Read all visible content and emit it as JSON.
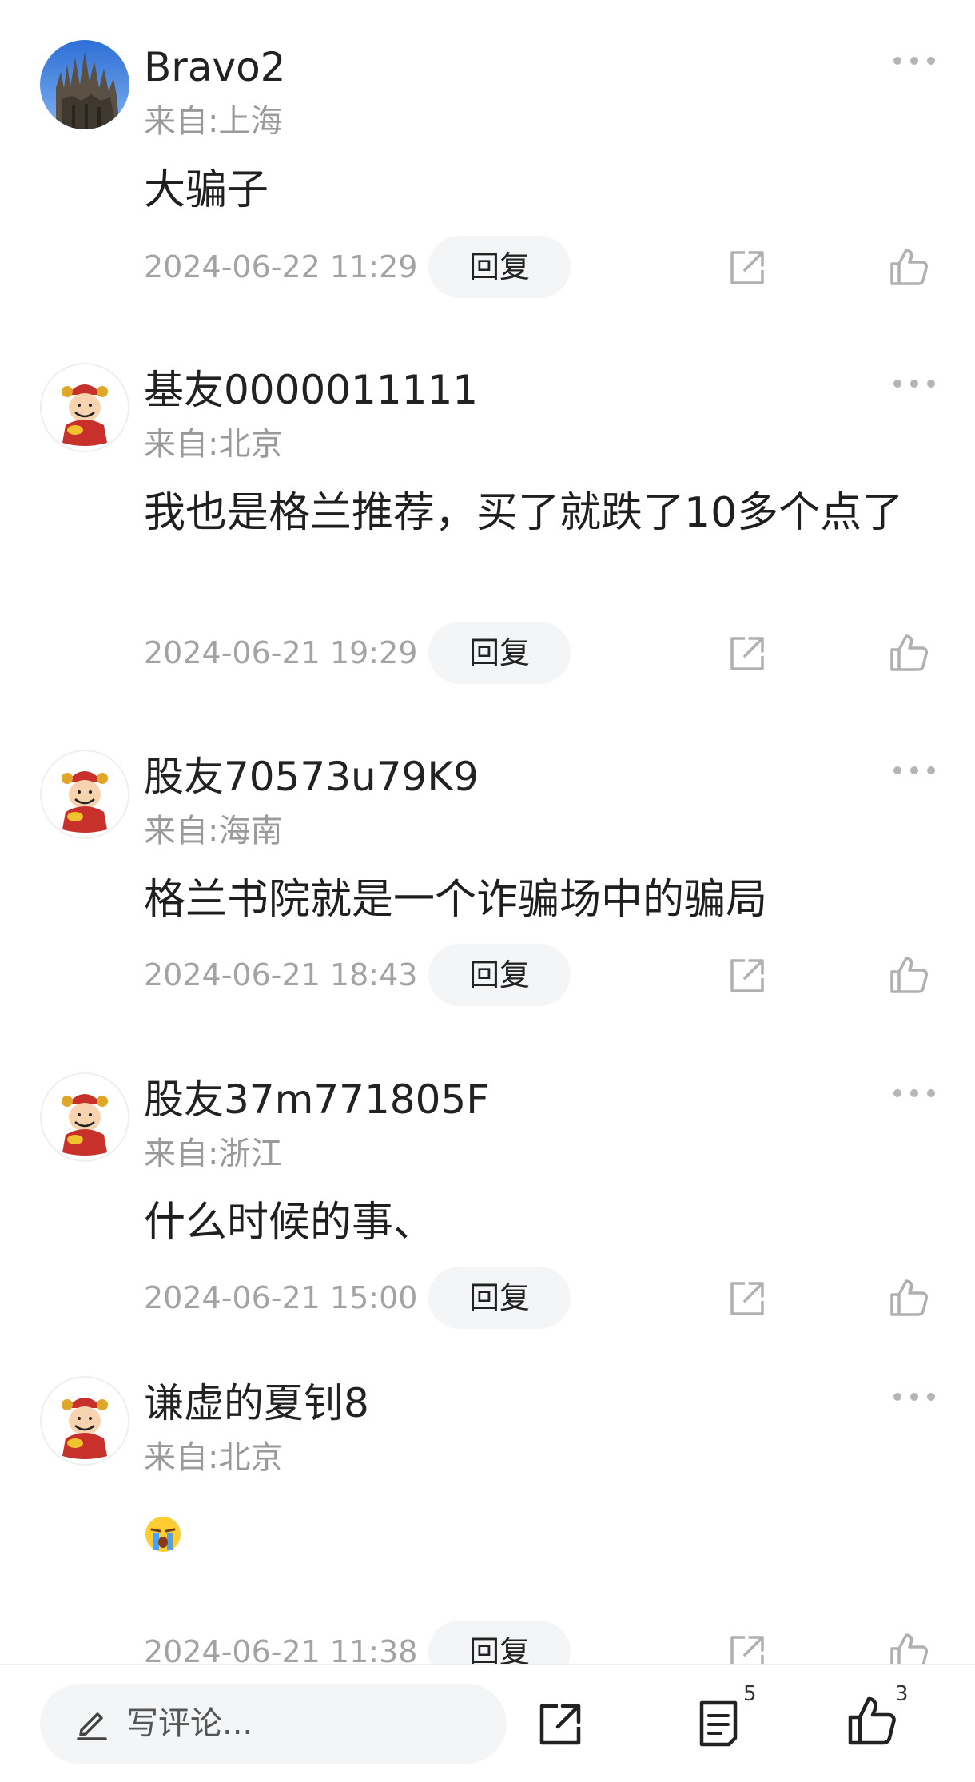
{
  "comments": [
    {
      "username": "Bravo2",
      "location": "来自:上海",
      "content": "大骗子",
      "time": "2024-06-22 11:29",
      "reply_label": "回复",
      "avatar_icon": "cathedral-photo-avatar"
    },
    {
      "username": "基友0000011111",
      "location": "来自:北京",
      "content": "我也是格兰推荐，买了就跌了10多个点了",
      "time": "2024-06-21 19:29",
      "reply_label": "回复",
      "avatar_icon": "fortune-god-avatar"
    },
    {
      "username": "股友70573u79K9",
      "location": "来自:海南",
      "content": "格兰书院就是一个诈骗场中的骗局",
      "time": "2024-06-21 18:43",
      "reply_label": "回复",
      "avatar_icon": "fortune-god-avatar"
    },
    {
      "username": "股友37m771805F",
      "location": "来自:浙江",
      "content": "什么时候的事、",
      "time": "2024-06-21 15:00",
      "reply_label": "回复",
      "avatar_icon": "fortune-god-avatar"
    },
    {
      "username": "谦虚的夏钊8",
      "location": "来自:北京",
      "content": "",
      "content_emoji": "crying-face-emoji",
      "time": "2024-06-21 11:38",
      "reply_label": "回复",
      "avatar_icon": "fortune-god-avatar"
    }
  ],
  "bottom_bar": {
    "comment_placeholder": "写评论...",
    "comment_count": "5",
    "like_count": "3"
  },
  "colors": {
    "text_primary": "#222222",
    "text_secondary": "#9a9a9a",
    "reply_button_bg": "#f4f5f7",
    "icon_gray": "#b0b0b0"
  }
}
